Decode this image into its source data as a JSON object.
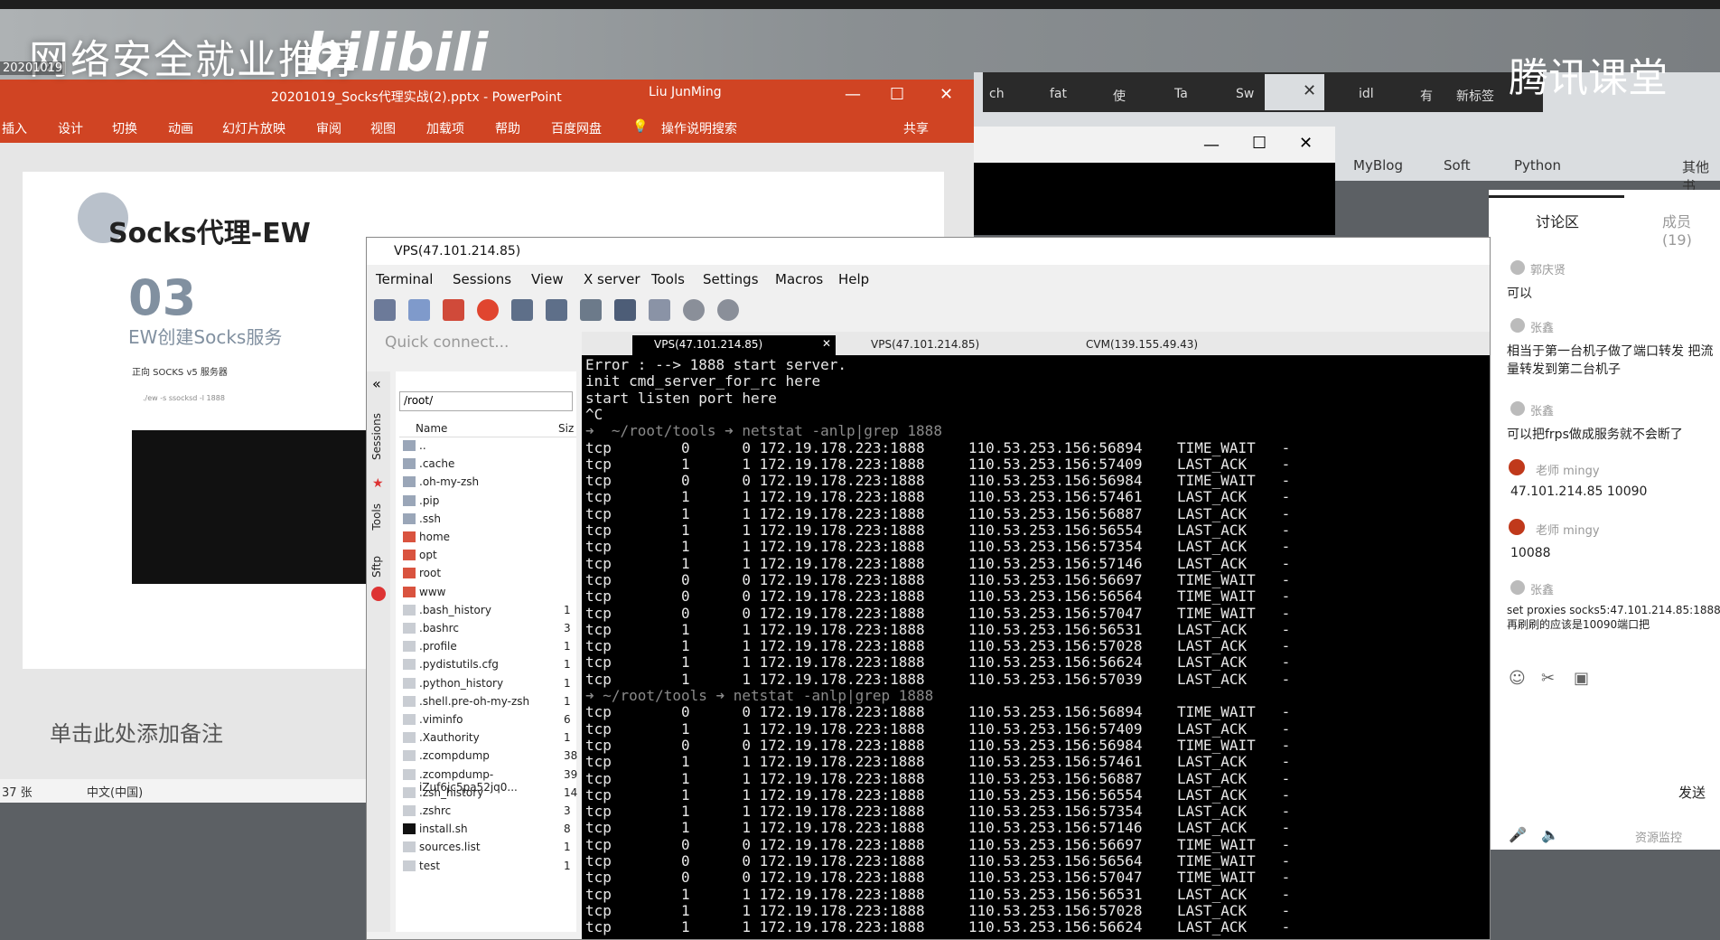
{
  "overlay": {
    "channel_title": "网络安全就业推荐",
    "date_stamp": "20201019",
    "bilibili": "bilibili",
    "tencent": "腾讯课堂"
  },
  "powerpoint": {
    "title": "20201019_Socks代理实战(2).pptx  -  PowerPoint",
    "user": "Liu JunMing",
    "ribbon": [
      "插入",
      "设计",
      "切换",
      "动画",
      "幻灯片放映",
      "审阅",
      "视图",
      "加载项",
      "帮助",
      "百度网盘",
      "操作说明搜索",
      "共享"
    ],
    "slide": {
      "title": "Socks代理-EW",
      "number": "03",
      "subtitle": "EW创建Socks服务",
      "small": "正向 SOCKS v5 服务器",
      "code": "./ew -s ssocksd -l 1888"
    },
    "notes_placeholder": "单击此处添加备注",
    "status": {
      "slides": "37 张",
      "lang": "中文(中国)"
    }
  },
  "browser": {
    "tabs": [
      "ch",
      "fat",
      "使",
      "Ta",
      "Sw",
      "idl",
      "有",
      "新标签"
    ],
    "bookmarks": [
      "MyBlog",
      "Soft",
      "Python",
      "其他书"
    ]
  },
  "chat": {
    "tab_discuss": "讨论区",
    "tab_members": "成员(19)",
    "messages": [
      {
        "name": "郭庆贤",
        "text": "可以"
      },
      {
        "name": "张鑫",
        "text": "相当于第一台机子做了端口转发 把流量转发到第二台机子"
      },
      {
        "name": "张鑫",
        "text": "可以把frps做成服务就不会断了"
      },
      {
        "name": "老师 mingy",
        "text": "47.101.214.85 10090"
      },
      {
        "name": "老师 mingy",
        "text": "10088"
      },
      {
        "name": "张鑫",
        "text": "set proxies socks5:47.101.214.85:1888 再刷刷的应该是10090端口把"
      }
    ],
    "send": "发送",
    "monitor": "资源监控"
  },
  "moba": {
    "title": "VPS(47.101.214.85)",
    "menu": [
      "Terminal",
      "Sessions",
      "View",
      "X server",
      "Tools",
      "Settings",
      "Macros",
      "Help"
    ],
    "quick_connect": "Quick connect...",
    "side_tabs": [
      "Sessions",
      "Tools",
      "Sftp"
    ],
    "path": "/root/",
    "col_name": "Name",
    "col_size": "Siz",
    "files": [
      {
        "name": "..",
        "size": ""
      },
      {
        "name": ".cache",
        "size": ""
      },
      {
        "name": ".oh-my-zsh",
        "size": ""
      },
      {
        "name": ".pip",
        "size": ""
      },
      {
        "name": ".ssh",
        "size": ""
      },
      {
        "name": "home",
        "size": ""
      },
      {
        "name": "opt",
        "size": ""
      },
      {
        "name": "root",
        "size": ""
      },
      {
        "name": "www",
        "size": ""
      },
      {
        "name": ".bash_history",
        "size": "1"
      },
      {
        "name": ".bashrc",
        "size": "3"
      },
      {
        "name": ".profile",
        "size": "1"
      },
      {
        "name": ".pydistutils.cfg",
        "size": "1"
      },
      {
        "name": ".python_history",
        "size": "1"
      },
      {
        "name": ".shell.pre-oh-my-zsh",
        "size": "1"
      },
      {
        "name": ".viminfo",
        "size": "6"
      },
      {
        "name": ".Xauthority",
        "size": "1"
      },
      {
        "name": ".zcompdump",
        "size": "38"
      },
      {
        "name": ".zcompdump-iZuf6jc5pa52jq0...",
        "size": "39"
      },
      {
        "name": ".zsh_history",
        "size": "14"
      },
      {
        "name": ".zshrc",
        "size": "3"
      },
      {
        "name": "install.sh",
        "size": "8"
      },
      {
        "name": "sources.list",
        "size": "1"
      },
      {
        "name": "test",
        "size": "1"
      }
    ],
    "term_tabs": [
      "VPS(47.101.214.85)",
      "VPS(47.101.214.85)",
      "CVM(139.155.49.43)"
    ],
    "terminal_lines": [
      "Error : --> 1888 start server.",
      "init cmd_server_for_rc here",
      "start listen port here",
      "^C",
      "➜  ~/root/tools ➜ netstat -anlp|grep 1888",
      "tcp        0      0 172.19.178.223:1888     110.53.253.156:56894    TIME_WAIT   -",
      "tcp        1      1 172.19.178.223:1888     110.53.253.156:57409    LAST_ACK    -",
      "tcp        0      0 172.19.178.223:1888     110.53.253.156:56984    TIME_WAIT   -",
      "tcp        1      1 172.19.178.223:1888     110.53.253.156:57461    LAST_ACK    -",
      "tcp        1      1 172.19.178.223:1888     110.53.253.156:56887    LAST_ACK    -",
      "tcp        1      1 172.19.178.223:1888     110.53.253.156:56554    LAST_ACK    -",
      "tcp        1      1 172.19.178.223:1888     110.53.253.156:57354    LAST_ACK    -",
      "tcp        1      1 172.19.178.223:1888     110.53.253.156:57146    LAST_ACK    -",
      "tcp        0      0 172.19.178.223:1888     110.53.253.156:56697    TIME_WAIT   -",
      "tcp        0      0 172.19.178.223:1888     110.53.253.156:56564    TIME_WAIT   -",
      "tcp        0      0 172.19.178.223:1888     110.53.253.156:57047    TIME_WAIT   -",
      "tcp        1      1 172.19.178.223:1888     110.53.253.156:56531    LAST_ACK    -",
      "tcp        1      1 172.19.178.223:1888     110.53.253.156:57028    LAST_ACK    -",
      "tcp        1      1 172.19.178.223:1888     110.53.253.156:56624    LAST_ACK    -",
      "tcp        1      1 172.19.178.223:1888     110.53.253.156:57039    LAST_ACK    -",
      "➜ ~/root/tools ➜ netstat -anlp|grep 1888",
      "tcp        0      0 172.19.178.223:1888     110.53.253.156:56894    TIME_WAIT   -",
      "tcp        1      1 172.19.178.223:1888     110.53.253.156:57409    LAST_ACK    -",
      "tcp        0      0 172.19.178.223:1888     110.53.253.156:56984    TIME_WAIT   -",
      "tcp        1      1 172.19.178.223:1888     110.53.253.156:57461    LAST_ACK    -",
      "tcp        1      1 172.19.178.223:1888     110.53.253.156:56887    LAST_ACK    -",
      "tcp        1      1 172.19.178.223:1888     110.53.253.156:56554    LAST_ACK    -",
      "tcp        1      1 172.19.178.223:1888     110.53.253.156:57354    LAST_ACK    -",
      "tcp        1      1 172.19.178.223:1888     110.53.253.156:57146    LAST_ACK    -",
      "tcp        0      0 172.19.178.223:1888     110.53.253.156:56697    TIME_WAIT   -",
      "tcp        0      0 172.19.178.223:1888     110.53.253.156:56564    TIME_WAIT   -",
      "tcp        0      0 172.19.178.223:1888     110.53.253.156:57047    TIME_WAIT   -",
      "tcp        1      1 172.19.178.223:1888     110.53.253.156:56531    LAST_ACK    -",
      "tcp        1      1 172.19.178.223:1888     110.53.253.156:57028    LAST_ACK    -",
      "tcp        1      1 172.19.178.223:1888     110.53.253.156:56624    LAST_ACK    -"
    ]
  }
}
